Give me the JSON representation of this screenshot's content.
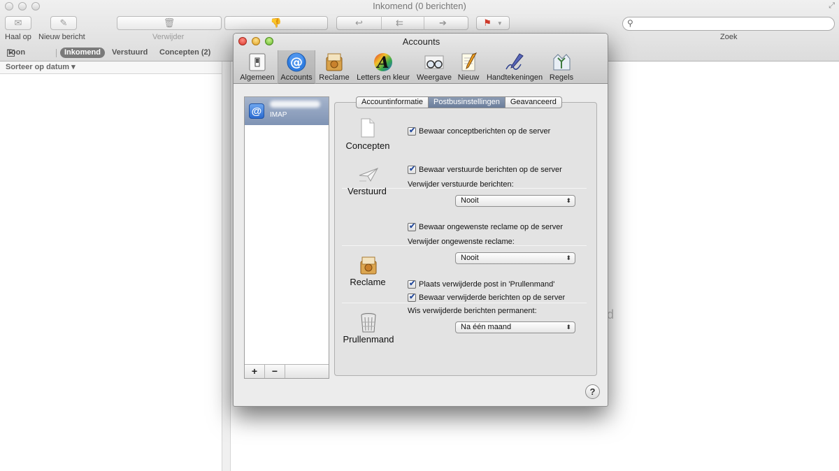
{
  "mail": {
    "title": "Inkomend (0 berichten)",
    "toolbar": {
      "get_mail_label": "Haal op",
      "new_message_label": "Nieuw bericht",
      "delete_label": "Verwijder",
      "search_label": "Zoek"
    },
    "favorites": {
      "show_label": "Toon",
      "inbox_label": "Inkomend",
      "sent_label": "Verstuurd",
      "drafts_label": "Concepten (2)"
    },
    "sort_label": "Sorteer op datum ▾",
    "background_text": "rd"
  },
  "prefs": {
    "title": "Accounts",
    "tabs": [
      {
        "label": "Algemeen",
        "icon": "switch-icon"
      },
      {
        "label": "Accounts",
        "icon": "at-sign-icon"
      },
      {
        "label": "Reclame",
        "icon": "junk-mail-icon"
      },
      {
        "label": "Letters en kleur",
        "icon": "fonts-colors-icon"
      },
      {
        "label": "Weergave",
        "icon": "glasses-icon"
      },
      {
        "label": "Nieuw",
        "icon": "compose-icon"
      },
      {
        "label": "Handtekeningen",
        "icon": "signature-pen-icon"
      },
      {
        "label": "Regels",
        "icon": "rules-icon"
      }
    ],
    "selected_tab": "Accounts",
    "account": {
      "type": "IMAP"
    },
    "add_label": "+",
    "remove_label": "−",
    "subtabs": [
      "Accountinformatie",
      "Postbusinstellingen",
      "Geavanceerd"
    ],
    "active_subtab": "Postbusinstellingen",
    "sections": {
      "drafts": {
        "label": "Concepten",
        "store_on_server": "Bewaar conceptberichten op de server"
      },
      "sent": {
        "label": "Verstuurd",
        "store_on_server": "Bewaar verstuurde berichten op de server",
        "erase_label": "Verwijder verstuurde berichten:",
        "erase_value": "Nooit"
      },
      "junk": {
        "label": "Reclame",
        "store_on_server": "Bewaar ongewenste reclame op de server",
        "erase_label": "Verwijder ongewenste reclame:",
        "erase_value": "Nooit"
      },
      "trash": {
        "label": "Prullenmand",
        "move_to_trash": "Plaats verwijderde post in 'Prullenmand'",
        "store_on_server": "Bewaar verwijderde berichten op de server",
        "erase_label": "Wis verwijderde berichten permanent:",
        "erase_value": "Na één maand"
      }
    },
    "help_label": "?"
  }
}
